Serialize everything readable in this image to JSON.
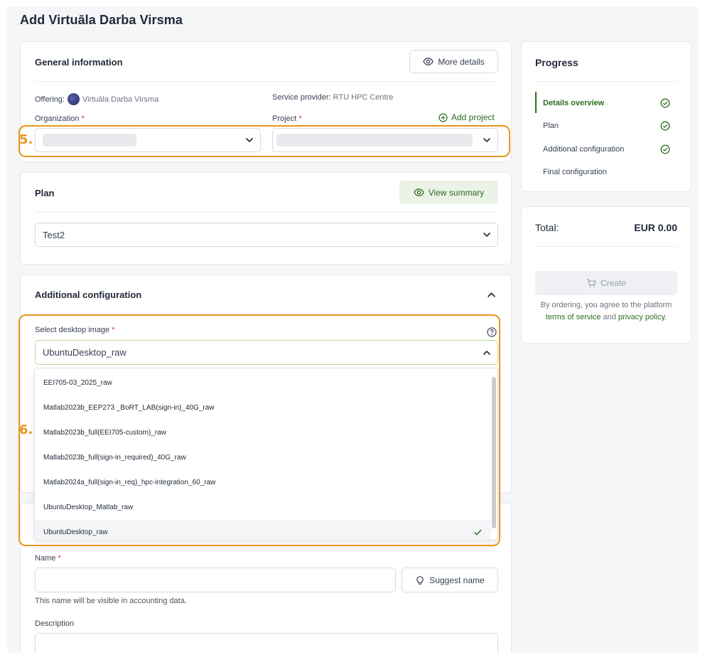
{
  "page": {
    "title": "Add Virtuāla Darba Virsma"
  },
  "general": {
    "title": "General information",
    "more_details": "More details",
    "offering_label": "Offering:",
    "offering_value": "Virtuāla Darba Virsma",
    "provider_label": "Service provider:",
    "provider_value": "RTU HPC Centre",
    "organization_label": "Organization",
    "project_label": "Project",
    "required_mark": "*",
    "add_project": "Add project"
  },
  "plan": {
    "title": "Plan",
    "view_summary": "View summary",
    "selected": "Test2"
  },
  "additional": {
    "title": "Additional configuration",
    "desktop_label": "Select desktop image",
    "desktop_value": "UbuntuDesktop_raw",
    "options": [
      "EEI705-03_2025_raw",
      "Matlab2023b_EEP273 _BoRT_LAB(sign-in)_40G_raw",
      "Matlab2023b_full(EEI705-custom)_raw",
      "Matlab2023b_full(sign-in_required)_40G_raw",
      "Matlab2024a_full(sign-in_req)_hpc-integration_60_raw",
      "UbuntuDesktop_Matlab_raw",
      "UbuntuDesktop_raw"
    ]
  },
  "final": {
    "name_label": "Name",
    "suggest_name": "Suggest name",
    "name_help": "This name will be visible in accounting data.",
    "description_label": "Description"
  },
  "progress": {
    "title": "Progress",
    "steps": [
      "Details overview",
      "Plan",
      "Additional configuration",
      "Final configuration"
    ]
  },
  "total": {
    "label": "Total:",
    "value": "EUR 0.00",
    "create": "Create",
    "terms_pre": "By ordering, you agree to the platform",
    "terms_link": "terms of service",
    "terms_and": "and",
    "privacy_link": "privacy policy",
    "terms_end": "."
  },
  "annotations": {
    "step5": "5.",
    "step6": "6."
  },
  "colors": {
    "accent": "#2f6b1f",
    "annotation": "#e8951f",
    "required": "#d32f2f"
  }
}
